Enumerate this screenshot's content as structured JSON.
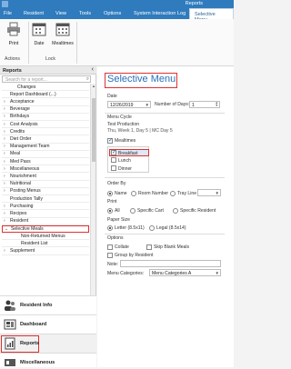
{
  "app": {
    "title": "Reports"
  },
  "menu": [
    "File",
    "Resident",
    "View",
    "Tools",
    "Options",
    "System Interaction Log",
    "Selective Menu"
  ],
  "ribbon": {
    "buttons": [
      "Print",
      "Date",
      "Mealtimes"
    ],
    "groups": [
      "Actions",
      "Lock"
    ]
  },
  "left": {
    "header": "Reports",
    "search_placeholder": "Search for a report...",
    "tree": [
      "Changes",
      "Report Dashboard (...)",
      "Acceptance",
      "Beverage",
      "Birthdays",
      "Cost Analysis",
      "Credits",
      "Diet Order",
      "Management Team",
      "Meal",
      "Med Pass",
      "Miscellaneous",
      "Nourishment",
      "Nutritional",
      "Posting Menus",
      "Production Tally",
      "Purchasing",
      "Recipes",
      "Resident",
      "Selective Meals",
      "Non-Returned Menus",
      "Resident List",
      "Supplement"
    ],
    "nav": [
      "Resident Info",
      "Dashboard",
      "Reports",
      "Miscellaneous"
    ]
  },
  "main": {
    "title": "Selective Menu",
    "date_label": "Date",
    "date_value": "12/26/2019",
    "days_label": "Number of Days:",
    "days_value": "1",
    "cycle_label": "Menu Cycle",
    "cycle_name": "Test Production",
    "cycle_info": "Thu, Week 1, Day 5 | MC Day 5",
    "mealtimes_label": "Mealtimes",
    "meals": [
      "Breakfast",
      "Lunch",
      "Dinner"
    ],
    "orderby_label": "Order By",
    "orderby": [
      "Name",
      "Room Number",
      "Tray Line"
    ],
    "print_label": "Print",
    "print_opts": [
      "All",
      "Specific Cart",
      "Specific Resident"
    ],
    "paper_label": "Paper Size",
    "paper_opts": [
      "Letter (8.5x11)",
      "Legal (8.5x14)"
    ],
    "options_label": "Options",
    "opts": [
      "Collate",
      "Skip Blank Meals",
      "Group by Resident"
    ],
    "note_label": "Note:",
    "categories_label": "Menu Categories:",
    "categories_value": "Menu Categories A"
  },
  "colors": {
    "accent": "#2f7bbd",
    "highlight": "#e03030"
  }
}
